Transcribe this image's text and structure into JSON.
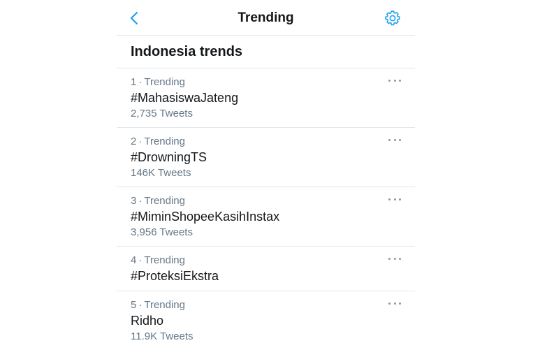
{
  "header": {
    "title": "Trending",
    "accent_color": "#1da1f2"
  },
  "section": {
    "title": "Indonesia trends"
  },
  "trends": [
    {
      "rank": "1",
      "label": "Trending",
      "name": "#MahasiswaJateng",
      "count": "2,735 Tweets"
    },
    {
      "rank": "2",
      "label": "Trending",
      "name": "#DrowningTS",
      "count": "146K Tweets"
    },
    {
      "rank": "3",
      "label": "Trending",
      "name": "#MiminShopeeKasihInstax",
      "count": "3,956 Tweets"
    },
    {
      "rank": "4",
      "label": "Trending",
      "name": "#ProteksiEkstra"
    },
    {
      "rank": "5",
      "label": "Trending",
      "name": "Ridho",
      "count": "11.9K Tweets"
    }
  ]
}
